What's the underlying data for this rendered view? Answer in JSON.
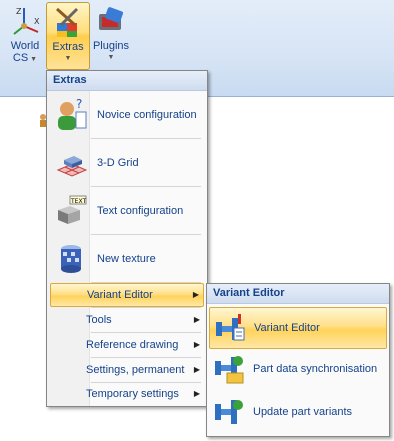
{
  "ribbon": {
    "world_cs": "World CS",
    "world_cs_line1": "World",
    "world_cs_line2": "CS",
    "extras": "Extras",
    "plugins": "Plugins"
  },
  "extras_menu": {
    "header": "Extras",
    "items": [
      {
        "label": "Novice configuration",
        "icon": "novice-person-icon"
      },
      {
        "label": "3-D Grid",
        "icon": "grid-3d-icon"
      },
      {
        "label": "Text configuration",
        "icon": "text-config-icon"
      },
      {
        "label": "New texture",
        "icon": "texture-icon"
      }
    ],
    "submenus": [
      {
        "label": "Variant Editor",
        "highlighted": true
      },
      {
        "label": "Tools"
      },
      {
        "label": "Reference drawing"
      },
      {
        "label": "Settings, permanent"
      },
      {
        "label": "Temporary settings"
      }
    ]
  },
  "variant_menu": {
    "header": "Variant Editor",
    "items": [
      {
        "label": "Variant Editor",
        "highlighted": true,
        "icon": "variant-editor-icon"
      },
      {
        "label": "Part data synchronisation",
        "icon": "part-sync-icon"
      },
      {
        "label": "Update part variants",
        "icon": "update-variants-icon"
      }
    ]
  },
  "colors": {
    "text": "#15428b",
    "highlight": "#ffd35a",
    "ribbon": "#d6e4f5"
  }
}
